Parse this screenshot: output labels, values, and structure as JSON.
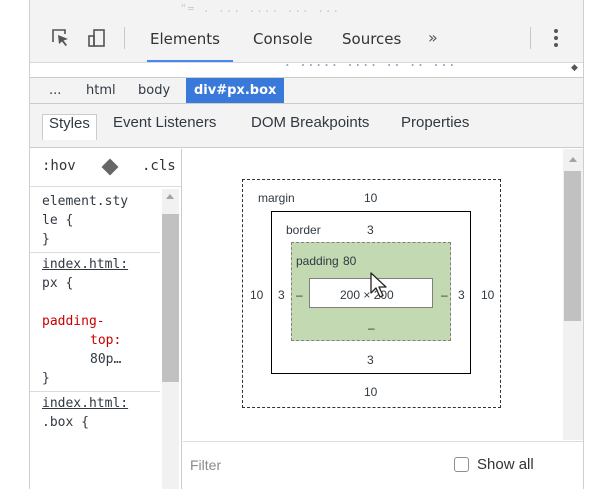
{
  "toolbar": {
    "ghost_code": "\"= . ... .... ... ...",
    "tabs": [
      "Elements",
      "Console",
      "Sources"
    ],
    "more": "»",
    "icons": [
      "inspect-element-icon",
      "device-toolbar-icon",
      "more-options-icon"
    ]
  },
  "dom_strip": {
    "ghost_code": "'' . ..... .... .. .. ...  '"
  },
  "breadcrumb": {
    "items": [
      "...",
      "html",
      "body",
      "div#px.box"
    ]
  },
  "subtabs": [
    "Styles",
    "Event Listeners",
    "DOM Breakpoints",
    "Properties"
  ],
  "styles": {
    "hov": ":hov",
    "cls": ".cls",
    "rule1": {
      "line1": "element.sty",
      "line2": "le {",
      "close": "}"
    },
    "rule2": {
      "source": "index.html:",
      "selector": "px {",
      "prop1": "padding-",
      "prop2": "top:",
      "value": "80p…",
      "close": "}"
    },
    "rule3": {
      "source": "index.html:",
      "selector": ".box {"
    }
  },
  "box_model": {
    "margin_label": "margin",
    "margin_top": "10",
    "margin_bottom": "10",
    "margin_left": "10",
    "margin_right": "10",
    "border_label": "border",
    "border_top": "3",
    "border_bottom": "3",
    "border_left": "3",
    "border_right": "3",
    "padding_label": "padding",
    "padding_top": "80",
    "padding_bottom": "–",
    "padding_left": "–",
    "padding_right": "–",
    "content": "200 × 200"
  },
  "filter": {
    "placeholder": "Filter",
    "show_all": "Show all"
  },
  "colors": {
    "accent": "#4688f1",
    "selected_crumb": "#3879d9",
    "padding_fill": "#c3d9b1",
    "css_property": "#c80000"
  }
}
